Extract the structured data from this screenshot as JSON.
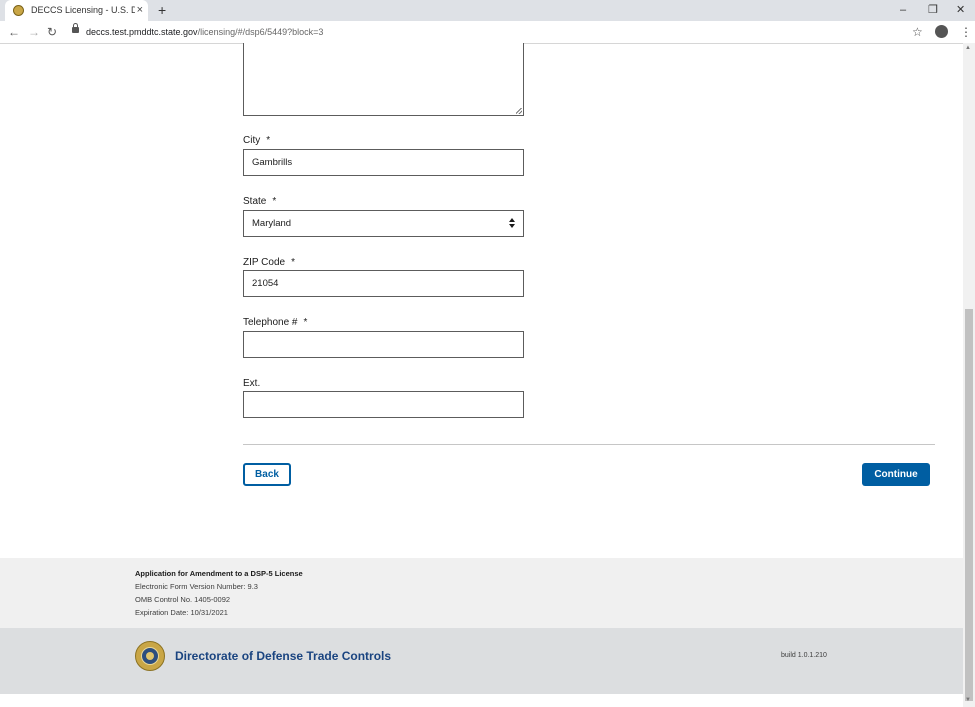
{
  "browser": {
    "tab_title": "DECCS Licensing - U.S. Departme",
    "tab_close": "×",
    "new_tab": "+",
    "url_host": "deccs.test.pmddtc.state.gov",
    "url_path": "/licensing/#/dsp6/5449?block=3",
    "window_controls": {
      "minimize": "–",
      "restore": "❐",
      "close": "✕"
    },
    "nav": {
      "back": "←",
      "forward": "→",
      "reload": "↻"
    },
    "star": "☆",
    "kebab": "⋮"
  },
  "form": {
    "required_mark": "*",
    "city": {
      "label": "City",
      "value": "Gambrills"
    },
    "state": {
      "label": "State",
      "value": "Maryland"
    },
    "zip": {
      "label": "ZIP Code",
      "value": "21054"
    },
    "telephone": {
      "label": "Telephone #",
      "value": ""
    },
    "ext": {
      "label": "Ext.",
      "value": ""
    },
    "back_label": "Back",
    "continue_label": "Continue"
  },
  "footer": {
    "form_title": "Application for Amendment to a DSP-5 License",
    "version": "Electronic Form Version Number: 9.3",
    "omb": "OMB Control No. 1405-0092",
    "expiration": "Expiration Date: 10/31/2021",
    "brand": "Directorate of Defense Trade Controls",
    "build": "build 1.0.1.210"
  },
  "colors": {
    "primary": "#005ea2",
    "brand_text": "#1a4480",
    "footer_bg": "#f0f0f0",
    "footer_brand_bg": "#dcdee0"
  }
}
